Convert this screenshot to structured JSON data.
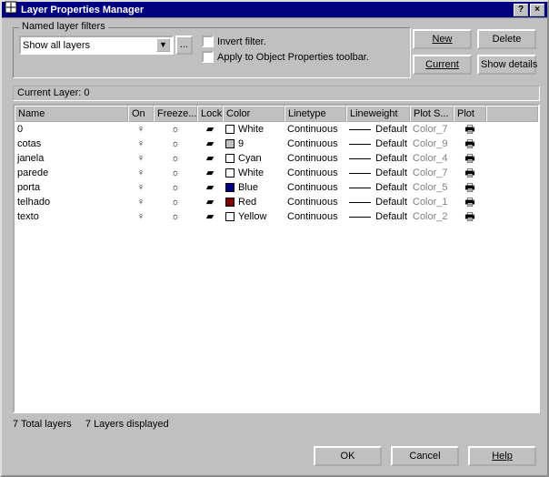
{
  "title": "Layer Properties Manager",
  "fieldset_legend": "Named layer filters",
  "filter_select_value": "Show all layers",
  "browse_btn": "...",
  "invert_label": "Invert filter.",
  "apply_label": "Apply to Object Properties toolbar.",
  "buttons": {
    "new": "New",
    "delete": "Delete",
    "current": "Current",
    "showdetails": "Show details",
    "ok": "OK",
    "cancel": "Cancel",
    "help": "Help"
  },
  "current_layer_label": "Current Layer:  0",
  "columns": {
    "name": "Name",
    "on": "On",
    "freeze": "Freeze...",
    "lock": "Lock",
    "color": "Color",
    "linetype": "Linetype",
    "lineweight": "Lineweight",
    "plotstyle": "Plot S...",
    "plot": "Plot"
  },
  "rows": [
    {
      "name": "0",
      "color": "White",
      "swatch": "#ffffff",
      "linetype": "Continuous",
      "lineweight": "Default",
      "plotstyle": "Color_7"
    },
    {
      "name": "cotas",
      "color": "9",
      "swatch": "#c0c0c0",
      "linetype": "Continuous",
      "lineweight": "Default",
      "plotstyle": "Color_9"
    },
    {
      "name": "janela",
      "color": "Cyan",
      "swatch": "#ffffff",
      "linetype": "Continuous",
      "lineweight": "Default",
      "plotstyle": "Color_4"
    },
    {
      "name": "parede",
      "color": "White",
      "swatch": "#ffffff",
      "linetype": "Continuous",
      "lineweight": "Default",
      "plotstyle": "Color_7"
    },
    {
      "name": "porta",
      "color": "Blue",
      "swatch": "#000080",
      "linetype": "Continuous",
      "lineweight": "Default",
      "plotstyle": "Color_5"
    },
    {
      "name": "telhado",
      "color": "Red",
      "swatch": "#800000",
      "linetype": "Continuous",
      "lineweight": "Default",
      "plotstyle": "Color_1"
    },
    {
      "name": "texto",
      "color": "Yellow",
      "swatch": "#ffffff",
      "linetype": "Continuous",
      "lineweight": "Default",
      "plotstyle": "Color_2"
    }
  ],
  "icons": {
    "on": "♀",
    "freeze": "☼",
    "lock": "▰",
    "plot": "🖶"
  },
  "status": {
    "total": "7 Total layers",
    "displayed": "7 Layers displayed"
  }
}
